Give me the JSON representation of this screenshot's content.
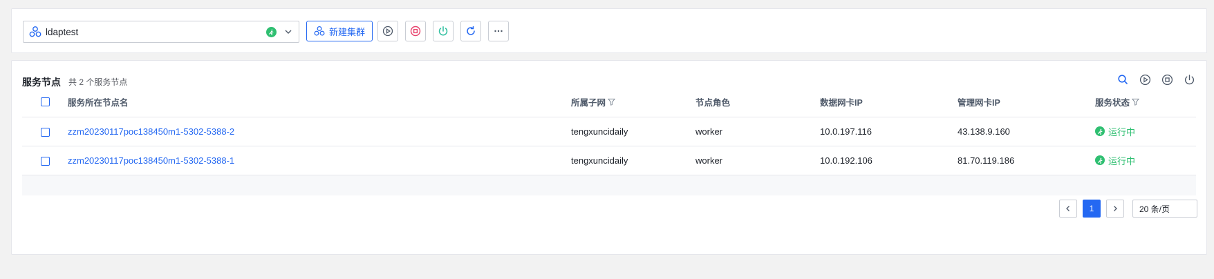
{
  "colors": {
    "accent": "#2468f2",
    "running": "#2fbf71",
    "stop": "#e8416b",
    "power": "#2fbf9f",
    "border": "#e5e6eb"
  },
  "toolbar": {
    "cluster_name": "ldaptest",
    "new_cluster_label": "新建集群",
    "icons": [
      "cluster-icon",
      "running-status-icon",
      "chevron-down-icon",
      "play-icon",
      "stop-icon",
      "power-icon",
      "refresh-icon",
      "more-icon"
    ]
  },
  "section": {
    "title": "服务节点",
    "count_text": "共 2 个服务节点",
    "actions": [
      "search-icon",
      "play-icon",
      "stop-icon",
      "power-icon"
    ]
  },
  "table": {
    "columns": [
      "服务所在节点名",
      "所属子网",
      "节点角色",
      "数据网卡IP",
      "管理网卡IP",
      "服务状态"
    ],
    "rows": [
      {
        "node_name": "zzm20230117poc138450m1-5302-5388-2",
        "subnet": "tengxuncidaily",
        "role": "worker",
        "data_ip": "10.0.197.116",
        "mgmt_ip": "43.138.9.160",
        "status": "运行中"
      },
      {
        "node_name": "zzm20230117poc138450m1-5302-5388-1",
        "subnet": "tengxuncidaily",
        "role": "worker",
        "data_ip": "10.0.192.106",
        "mgmt_ip": "81.70.119.186",
        "status": "运行中"
      }
    ]
  },
  "pagination": {
    "current_page": "1",
    "page_size": "20 条/页"
  }
}
